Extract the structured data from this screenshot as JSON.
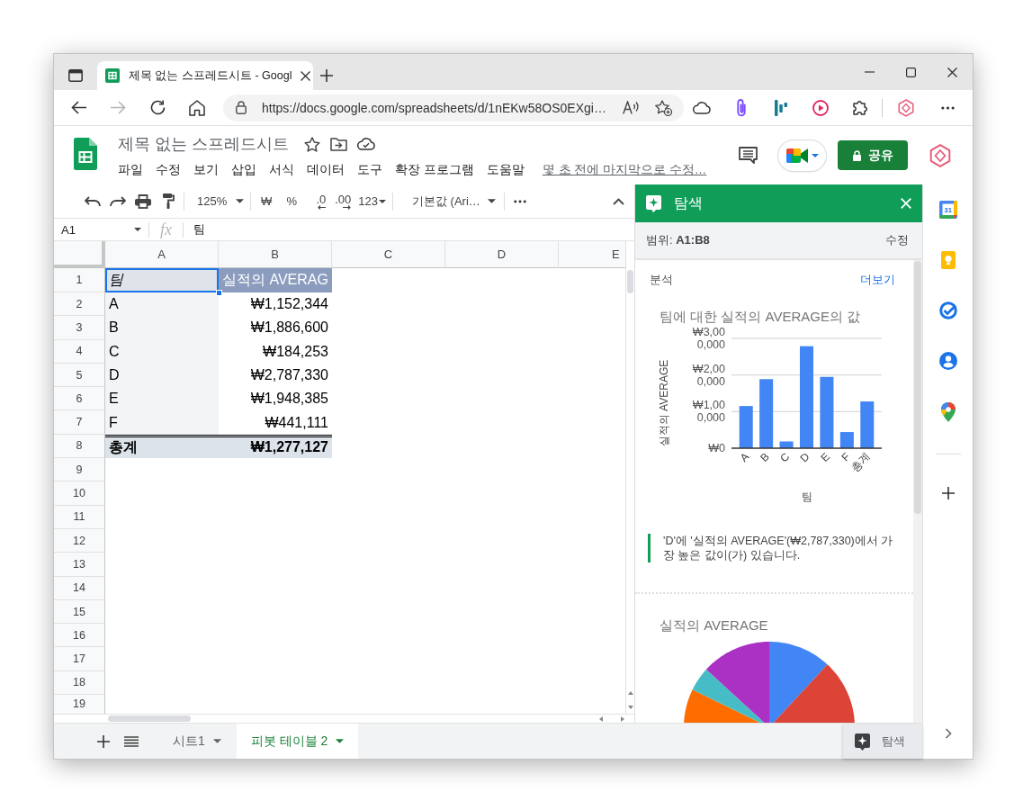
{
  "browser": {
    "tab_title": "제목 없는 스프레드시트 - Googl",
    "url": "https://docs.google.com/spreadsheets/d/1nEKw58OS0EXgi…"
  },
  "document": {
    "title": "제목 없는 스프레드시트",
    "menu": [
      "파일",
      "수정",
      "보기",
      "삽입",
      "서식",
      "데이터",
      "도구",
      "확장 프로그램",
      "도움말"
    ],
    "last_edit": "몇 초 전에 마지막으로 수정…",
    "share": "공유"
  },
  "toolbar": {
    "zoom": "125%",
    "currency": "₩",
    "percent": "%",
    "decrease_decimals": ".0",
    "increase_decimals": ".00",
    "number_format": "123",
    "font": "기본값 (Ari…"
  },
  "formula_bar": {
    "cell": "A1",
    "fx": "fx",
    "value": "팀"
  },
  "sheet": {
    "columns": [
      "A",
      "B",
      "C",
      "D",
      "E"
    ],
    "row_numbers": [
      "1",
      "2",
      "3",
      "4",
      "5",
      "6",
      "7",
      "8",
      "9",
      "10",
      "11",
      "12",
      "13",
      "14",
      "15",
      "16",
      "17",
      "18",
      "19"
    ],
    "rows": [
      {
        "kind": "header",
        "cells": [
          {
            "text": "팀",
            "selected": true
          },
          {
            "text": "실적의 AVERAG",
            "selected": false
          }
        ]
      },
      {
        "kind": "data",
        "cells": [
          {
            "text": "A",
            "selected": false
          },
          {
            "text": "₩1,152,344",
            "selected": false
          }
        ]
      },
      {
        "kind": "data",
        "cells": [
          {
            "text": "B",
            "selected": false
          },
          {
            "text": "₩1,886,600",
            "selected": false
          }
        ]
      },
      {
        "kind": "data",
        "cells": [
          {
            "text": "C",
            "selected": false
          },
          {
            "text": "₩184,253",
            "selected": false
          }
        ]
      },
      {
        "kind": "data",
        "cells": [
          {
            "text": "D",
            "selected": false
          },
          {
            "text": "₩2,787,330",
            "selected": false
          }
        ]
      },
      {
        "kind": "data",
        "cells": [
          {
            "text": "E",
            "selected": false
          },
          {
            "text": "₩1,948,385",
            "selected": false
          }
        ]
      },
      {
        "kind": "data",
        "cells": [
          {
            "text": "F",
            "selected": false
          },
          {
            "text": "₩441,111",
            "selected": false
          }
        ]
      },
      {
        "kind": "total",
        "cells": [
          {
            "text": "총계",
            "selected": false
          },
          {
            "text": "₩1,277,127",
            "selected": false
          }
        ]
      }
    ]
  },
  "explore": {
    "title": "탐색",
    "range": "범위: **A1:B8**",
    "edit": "수정",
    "heading": "분석",
    "more": "더보기",
    "chart_data": {
      "type": "bar",
      "title": "팀에 대한 실적의 AVERAGE의 값",
      "xlabel": "팀",
      "ylabel": "실적의 AVERAGE",
      "categories": [
        "A",
        "B",
        "C",
        "D",
        "E",
        "F",
        "총계"
      ],
      "values": [
        1152344,
        1886600,
        184253,
        2787330,
        1948385,
        441111,
        1277127
      ],
      "ylim": [
        0,
        3000000
      ],
      "yticks": [
        {
          "value": 0,
          "label": "₩0"
        },
        {
          "value": 1000000,
          "label": "₩1,000,000"
        },
        {
          "value": 2000000,
          "label": "₩2,000,000"
        },
        {
          "value": 3000000,
          "label": "₩3,000,000"
        }
      ]
    },
    "insight": "'D'에 '실적의 AVERAGE'(₩2,787,330)에서 가장 높은 값이(가) 있습니다.",
    "pie_title": "실적의 AVERAGE"
  },
  "sheet_bar": {
    "tabs": [
      {
        "label": "시트1",
        "selected": false
      },
      {
        "label": "피봇 테이블 2",
        "selected": true
      }
    ],
    "explore_button": "탐색"
  },
  "side_panel": {
    "calendar_day": "31"
  }
}
